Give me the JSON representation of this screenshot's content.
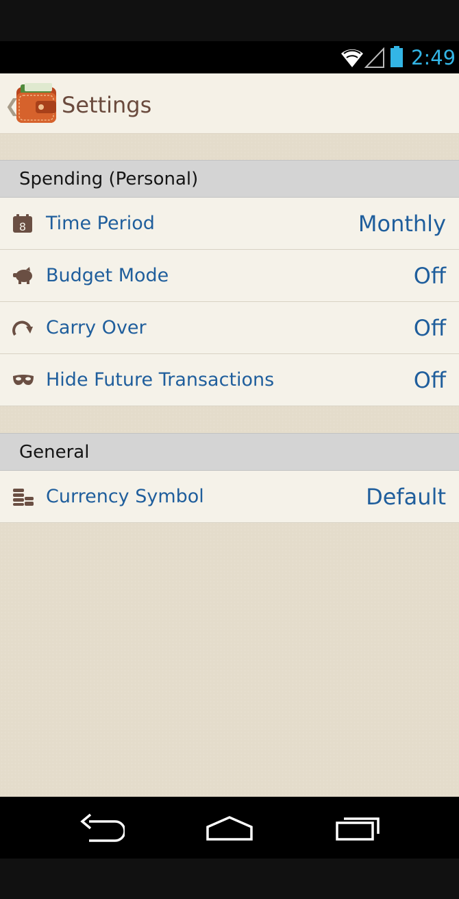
{
  "status_bar": {
    "time": "2:49",
    "accent_color": "#33b5e5"
  },
  "action_bar": {
    "title": "Settings",
    "icon": "wallet-app-icon"
  },
  "sections": [
    {
      "header": "Spending (Personal)",
      "items": [
        {
          "icon": "calendar-icon",
          "icon_text": "8",
          "label": "Time Period",
          "value": "Monthly"
        },
        {
          "icon": "piggy-bank-icon",
          "label": "Budget Mode",
          "value": "Off"
        },
        {
          "icon": "carry-over-arrow-icon",
          "label": "Carry Over",
          "value": "Off"
        },
        {
          "icon": "mask-icon",
          "label": "Hide Future Transactions",
          "value": "Off"
        }
      ]
    },
    {
      "header": "General",
      "items": [
        {
          "icon": "coins-icon",
          "label": "Currency Symbol",
          "value": "Default"
        }
      ]
    }
  ],
  "nav_bar": {
    "buttons": [
      "back-icon",
      "home-icon",
      "recent-apps-icon"
    ]
  },
  "colors": {
    "link_blue": "#1f5e9c",
    "title_brown": "#6a4a3d",
    "background": "#e4dccb"
  }
}
